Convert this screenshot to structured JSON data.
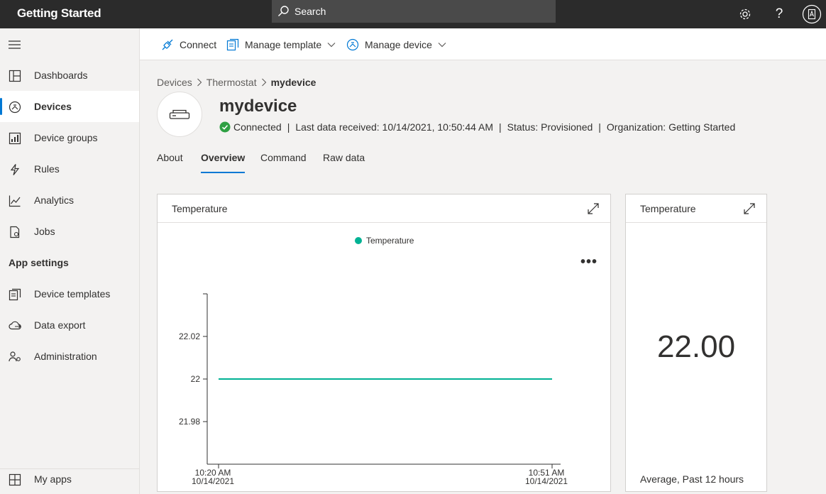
{
  "topbar": {
    "app_title": "Getting Started",
    "search_label": "Search",
    "icons": [
      "settings-icon",
      "help-icon",
      "account-icon"
    ]
  },
  "sidebar": {
    "items": [
      {
        "label": "Dashboards",
        "icon": "dashboard-icon"
      },
      {
        "label": "Devices",
        "icon": "devices-icon",
        "active": true
      },
      {
        "label": "Device groups",
        "icon": "device-groups-icon"
      },
      {
        "label": "Rules",
        "icon": "rules-icon"
      },
      {
        "label": "Analytics",
        "icon": "analytics-icon"
      },
      {
        "label": "Jobs",
        "icon": "jobs-icon"
      }
    ],
    "section_title": "App settings",
    "settings_items": [
      {
        "label": "Device templates",
        "icon": "device-templates-icon"
      },
      {
        "label": "Data export",
        "icon": "data-export-icon"
      },
      {
        "label": "Administration",
        "icon": "administration-icon"
      }
    ],
    "bottom_item": {
      "label": "My apps",
      "icon": "my-apps-icon"
    }
  },
  "commandbar": {
    "connect": "Connect",
    "manage_template": "Manage template",
    "manage_device": "Manage device"
  },
  "breadcrumb": {
    "root": "Devices",
    "parent": "Thermostat",
    "current": "mydevice"
  },
  "device": {
    "name": "mydevice",
    "status_connected": "Connected",
    "last_data": "Last data received: 10/14/2021, 10:50:44 AM",
    "status": "Status: Provisioned",
    "organization": "Organization: Getting Started",
    "pipe": "|"
  },
  "tabs": [
    {
      "label": "About"
    },
    {
      "label": "Overview",
      "active": true
    },
    {
      "label": "Command"
    },
    {
      "label": "Raw data"
    }
  ],
  "line_card": {
    "title": "Temperature",
    "more_label": "•••"
  },
  "kpi_card": {
    "title": "Temperature",
    "value": "22.00",
    "caption": "Average, Past 12 hours"
  },
  "colors": {
    "accent": "#0078d4",
    "series": "#00b294",
    "connected": "#2ea043",
    "topbar": "#2b2b2b"
  },
  "chart_data": {
    "type": "line",
    "series": [
      {
        "name": "Temperature",
        "x": [
          "10:20 AM 10/14/2021",
          "10:51 AM 10/14/2021"
        ],
        "values": [
          22,
          22
        ]
      }
    ],
    "y_ticks": [
      21.98,
      22,
      22.02
    ],
    "ylim": [
      21.96,
      22.04
    ],
    "x_ticks": [
      {
        "time": "10:20 AM",
        "date": "10/14/2021"
      },
      {
        "time": "10:51 AM",
        "date": "10/14/2021"
      }
    ],
    "legend": "top-center"
  }
}
